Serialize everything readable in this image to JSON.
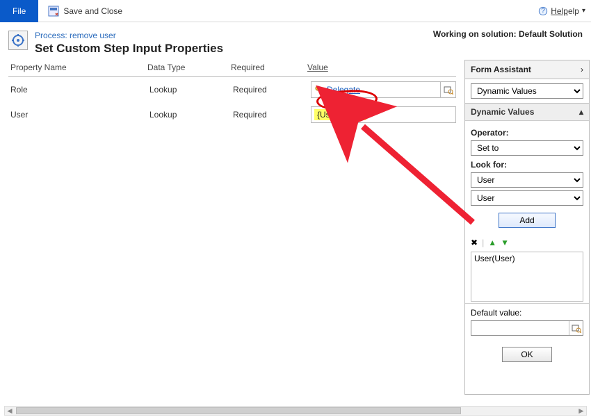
{
  "topbar": {
    "file": "File",
    "save_close": "Save and Close",
    "help": "Help"
  },
  "header": {
    "process_prefix": "Process: ",
    "process_name": "remove user",
    "title": "Set Custom Step Input Properties",
    "working_on": "Working on solution: Default Solution"
  },
  "columns": {
    "name": "Property Name",
    "type": "Data Type",
    "required": "Required",
    "value": "Value"
  },
  "rows": [
    {
      "name": "Role",
      "type": "Lookup",
      "req": "Required",
      "value_kind": "delegate",
      "value": "Delegate"
    },
    {
      "name": "User",
      "type": "Lookup",
      "req": "Required",
      "value_kind": "token",
      "value": "{User(User)}"
    }
  ],
  "assistant": {
    "title": "Form Assistant",
    "dropdown": "Dynamic Values",
    "section": "Dynamic Values",
    "operator_label": "Operator:",
    "operator": "Set to",
    "lookfor_label": "Look for:",
    "lookfor_top": "User",
    "lookfor_bottom": "User",
    "add": "Add",
    "list_item": "User(User)",
    "default_label": "Default value:",
    "ok": "OK"
  }
}
